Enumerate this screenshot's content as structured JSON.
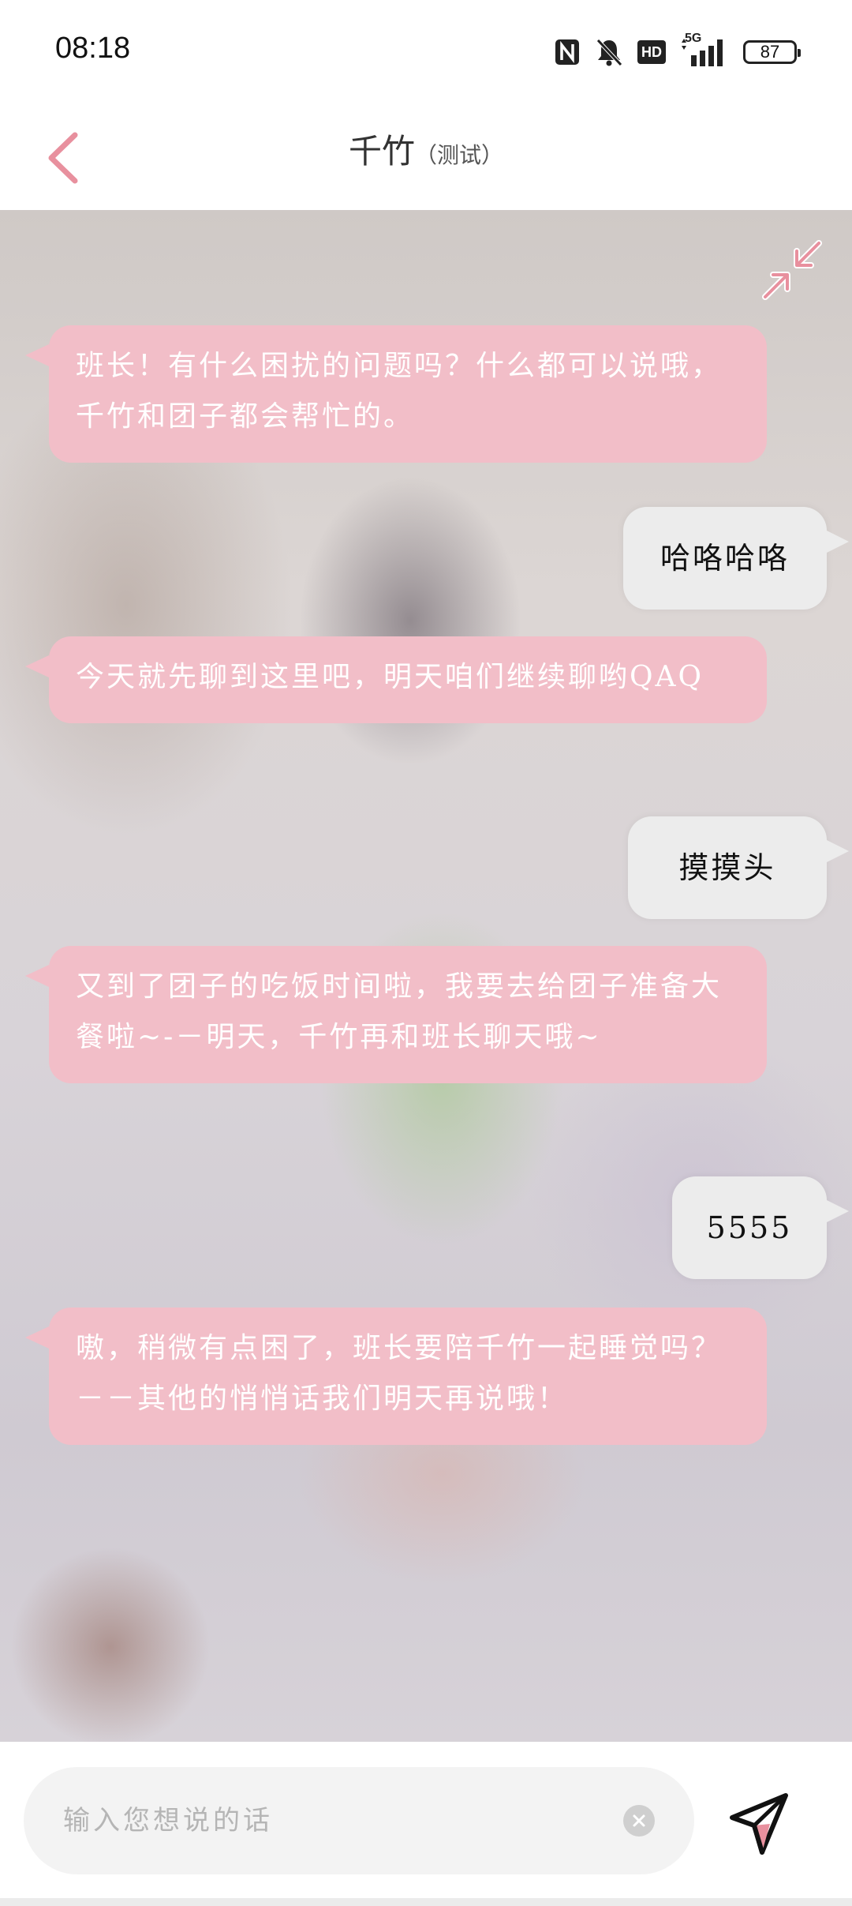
{
  "status_bar": {
    "time": "08:18",
    "icons": [
      "nfc-icon",
      "mute-bell-icon",
      "hd-icon",
      "signal-5g-icon"
    ],
    "network": "5G",
    "hd": "HD",
    "battery": "87"
  },
  "header": {
    "back_icon": "chevron-left-icon",
    "name": "千竹",
    "sub": "（测试）"
  },
  "chat": {
    "collapse_icon": "collapse-arrows-icon",
    "messages": [
      {
        "from": "bot",
        "text": "班长！有什么困扰的问题吗？什么都可以说哦，千竹和团子都会帮忙的。"
      },
      {
        "from": "user",
        "text": "哈咯哈咯"
      },
      {
        "from": "bot",
        "text": "今天就先聊到这里吧，明天咱们继续聊哟QAQ"
      },
      {
        "from": "user",
        "text": "摸摸头"
      },
      {
        "from": "bot",
        "text": "又到了团子的吃饭时间啦，我要去给团子准备大餐啦~-－明天，千竹再和班长聊天哦~"
      },
      {
        "from": "user",
        "text": "5555"
      },
      {
        "from": "bot",
        "text": "嗷，稍微有点困了，班长要陪千竹一起睡觉吗？－－其他的悄悄话我们明天再说哦！"
      }
    ]
  },
  "input": {
    "placeholder": "输入您想说的话",
    "value": "",
    "clear_icon": "clear-circle-icon",
    "send_icon": "send-paper-plane-icon"
  },
  "colors": {
    "accent": "#e8909e",
    "bot_bubble": "#f2bec8",
    "user_bubble": "#ececec"
  }
}
